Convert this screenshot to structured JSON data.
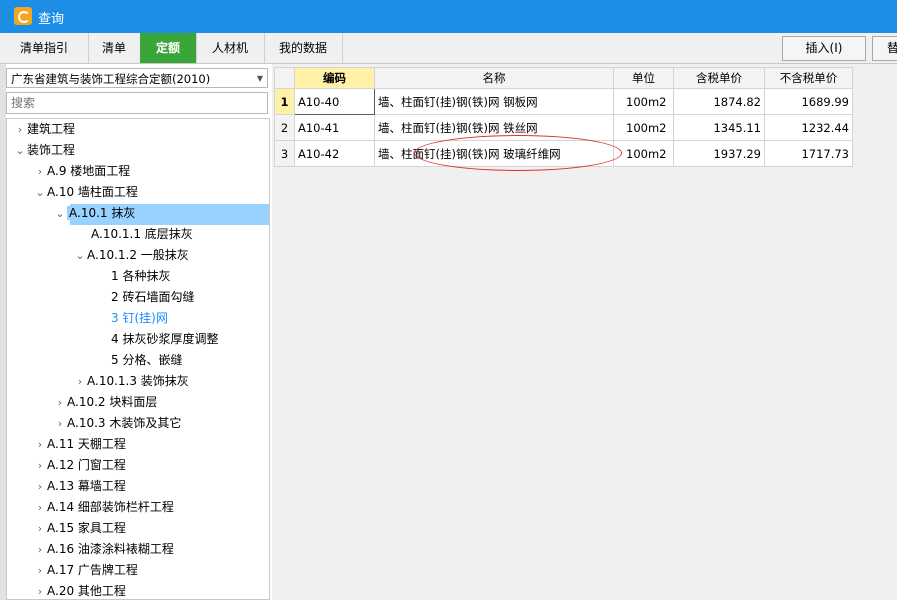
{
  "window": {
    "title": "查询"
  },
  "tabs": [
    {
      "label": "清单指引",
      "active": false
    },
    {
      "label": "清单",
      "active": false
    },
    {
      "label": "定额",
      "active": true
    },
    {
      "label": "人材机",
      "active": false
    },
    {
      "label": "我的数据",
      "active": false
    }
  ],
  "toolbar": {
    "insert_label": "插入(I)",
    "second_label": "替"
  },
  "left": {
    "library": "广东省建筑与装饰工程综合定额(2010)",
    "search_placeholder": "搜索"
  },
  "tree": [
    {
      "chev": "›",
      "label": "建筑工程"
    },
    {
      "chev": "⌄",
      "label": "装饰工程"
    },
    {
      "chev": "›",
      "label": "A.9 楼地面工程"
    },
    {
      "chev": "⌄",
      "label": "A.10 墙柱面工程"
    },
    {
      "chev": "⌄",
      "label": "A.10.1 抹灰"
    },
    {
      "chev": "",
      "label": "A.10.1.1 底层抹灰"
    },
    {
      "chev": "⌄",
      "label": "A.10.1.2 一般抹灰"
    },
    {
      "chev": "",
      "label": "1 各种抹灰"
    },
    {
      "chev": "",
      "label": "2 砖石墙面勾缝"
    },
    {
      "chev": "",
      "label": "3 钉(挂)网"
    },
    {
      "chev": "",
      "label": "4 抹灰砂浆厚度调整"
    },
    {
      "chev": "",
      "label": "5 分格、嵌缝"
    },
    {
      "chev": "›",
      "label": "A.10.1.3 装饰抹灰"
    },
    {
      "chev": "›",
      "label": "A.10.2 块料面层"
    },
    {
      "chev": "›",
      "label": "A.10.3 木装饰及其它"
    },
    {
      "chev": "›",
      "label": "A.11 天棚工程"
    },
    {
      "chev": "›",
      "label": "A.12 门窗工程"
    },
    {
      "chev": "›",
      "label": "A.13 幕墙工程"
    },
    {
      "chev": "›",
      "label": "A.14 细部装饰栏杆工程"
    },
    {
      "chev": "›",
      "label": "A.15 家具工程"
    },
    {
      "chev": "›",
      "label": "A.16 油漆涂料裱糊工程"
    },
    {
      "chev": "›",
      "label": "A.17 广告牌工程"
    },
    {
      "chev": "›",
      "label": "A.20 其他工程"
    }
  ],
  "grid": {
    "columns": [
      "编码",
      "名称",
      "单位",
      "含税单价",
      "不含税单价"
    ],
    "rows": [
      {
        "no": "1",
        "code": "A10-40",
        "name": "墙、柱面钉(挂)钢(铁)网 钢板网",
        "unit": "100m2",
        "price_tax": "1874.82",
        "price_notax": "1689.99"
      },
      {
        "no": "2",
        "code": "A10-41",
        "name": "墙、柱面钉(挂)钢(铁)网 铁丝网",
        "unit": "100m2",
        "price_tax": "1345.11",
        "price_notax": "1232.44"
      },
      {
        "no": "3",
        "code": "A10-42",
        "name": "墙、柱面钉(挂)钢(铁)网 玻璃纤维网",
        "unit": "100m2",
        "price_tax": "1937.29",
        "price_notax": "1717.73"
      }
    ]
  },
  "colors": {
    "titlebar": "#1c8ee6",
    "active_tab": "#3aa63a",
    "selection": "#99d1ff",
    "link": "#1a8cff",
    "annotation": "#e03030"
  }
}
